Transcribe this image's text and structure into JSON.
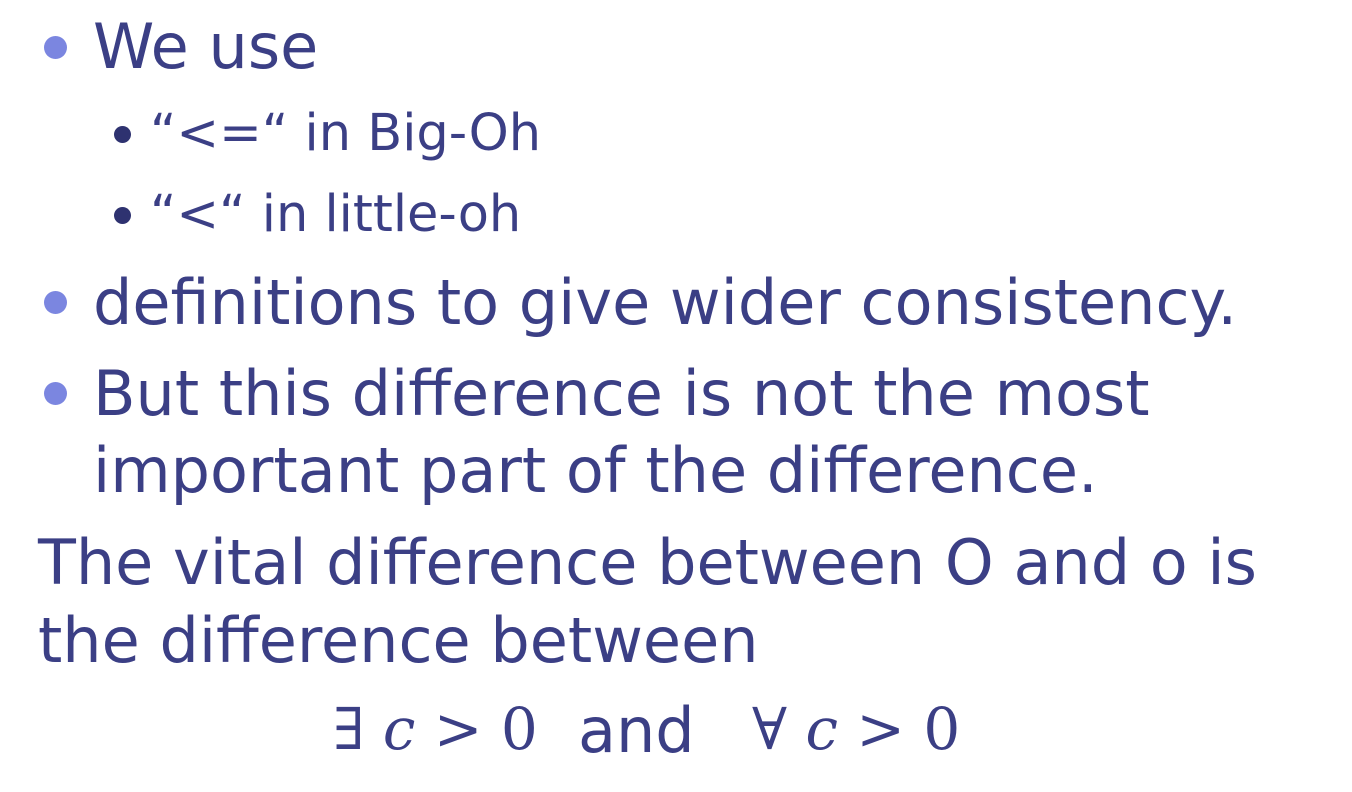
{
  "bullets": [
    {
      "text": "We use"
    },
    {
      "text": "“<=“ in Big-Oh"
    },
    {
      "text": "“<“ in little-oh"
    },
    {
      "text": "definitions to give wider consistency."
    },
    {
      "lines": [
        "But this difference is not the most",
        "important part of the difference."
      ]
    }
  ],
  "statement": {
    "lines": [
      "The vital difference between O and o is",
      "the difference between"
    ]
  },
  "formula": {
    "exists_symbol": "∃",
    "forall_symbol": "∀",
    "variable": "c",
    "relation": "> 0",
    "connector": "and"
  }
}
